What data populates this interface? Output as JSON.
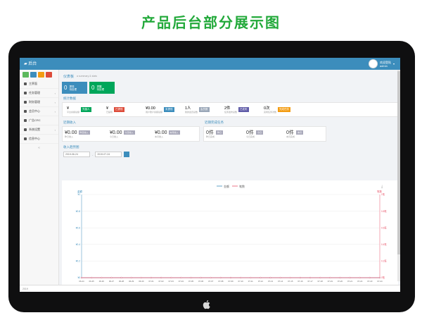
{
  "banner": "产品后台部分展示图",
  "app": {
    "title": "后台",
    "user_name": "欢迎登陆",
    "user_sub": "admin"
  },
  "sidebar": {
    "top_buttons": [
      {
        "name": "home-shortcut-button",
        "color": "#5cb85c"
      },
      {
        "name": "edit-shortcut-button",
        "color": "#3c8dbc"
      },
      {
        "name": "user-shortcut-button",
        "color": "#f39c12"
      },
      {
        "name": "settings-shortcut-button",
        "color": "#dd4b39"
      }
    ],
    "items": [
      {
        "label": "主界面",
        "icon": "home-icon",
        "arrow": ""
      },
      {
        "label": "任务管理",
        "icon": "flag-icon",
        "arrow": "‹"
      },
      {
        "label": "财务管理",
        "icon": "money-icon",
        "arrow": "‹"
      },
      {
        "label": "会员中心",
        "icon": "user-icon",
        "arrow": "‹"
      },
      {
        "label": "广告CRC",
        "icon": "ad-icon",
        "arrow": ""
      },
      {
        "label": "系统设置",
        "icon": "gear-icon",
        "arrow": "‹"
      },
      {
        "label": "信息中心",
        "icon": "message-icon",
        "arrow": ""
      }
    ]
  },
  "main": {
    "breadcrumb": "仪表板",
    "breadcrumb_sub": "a summary & stats",
    "cards": [
      {
        "num": "0",
        "label": "提现",
        "sub": "待处理",
        "color": "#3c8dbc"
      },
      {
        "num": "0",
        "label": "提醒",
        "sub": "待处理",
        "color": "#00a65a"
      }
    ],
    "stats_title": "统计数据",
    "stats": [
      {
        "val": "¥",
        "cap": "平台余额总额",
        "tag": "充值人",
        "tag_color": "#00a65a"
      },
      {
        "val": "¥",
        "cap": "已提现",
        "tag": "已提现",
        "tag_color": "#dd4b39"
      },
      {
        "val": "¥0.00",
        "cap": "用户账户余额总额",
        "tag": "未提现",
        "tag_color": "#3c8dbc"
      },
      {
        "val": "1人",
        "cap": "我的会员总数",
        "tag": "会员数",
        "tag_color": "#9aa7b8"
      },
      {
        "val": "2件",
        "cap": "任务发布总数",
        "tag": "已发布",
        "tag_color": "#605ca8"
      },
      {
        "val": "0次",
        "cap": "完成任务次数",
        "tag": "完成任务",
        "tag_color": "#f39c12"
      }
    ],
    "recent_income_title": "近期收入",
    "income": [
      {
        "val": "¥0.00",
        "cap": "昨日收入",
        "tag": "昨日收入"
      },
      {
        "val": "¥0.00",
        "cap": "今日收入",
        "tag": "今日收入"
      },
      {
        "val": "¥0.00",
        "cap": "本月收入",
        "tag": "本月收入"
      }
    ],
    "recent_tasks_title": "近期完成任务",
    "tasks": [
      {
        "val": "0件",
        "cap": "昨日完成",
        "tag": "昨日"
      },
      {
        "val": "0件",
        "cap": "今日完成",
        "tag": "今日"
      },
      {
        "val": "0件",
        "cap": "本月完成",
        "tag": "本月"
      }
    ],
    "trend_title": "收入趋势图",
    "date_from": "2019-06-24",
    "date_to": "2019-07-24"
  },
  "chart_data": {
    "type": "line",
    "title": "",
    "legend": [
      "金额",
      "笔数"
    ],
    "xlabel": "",
    "y_left_label": "金额",
    "y_right_label": "笔数",
    "ylim_left": [
      0,
      1
    ],
    "ylim_right": [
      0,
      1
    ],
    "y_left_ticks": [
      "¥1",
      "¥0.8",
      "¥0.6",
      "¥0.4",
      "¥0.2",
      "¥0"
    ],
    "y_right_ticks": [
      "1笔",
      "0.8笔",
      "0.6笔",
      "0.4笔",
      "0.2笔",
      "0笔"
    ],
    "categories": [
      "06-24",
      "06-25",
      "06-26",
      "06-27",
      "06-28",
      "06-29",
      "06-30",
      "07-01",
      "07-02",
      "07-03",
      "07-04",
      "07-05",
      "07-06",
      "07-07",
      "07-08",
      "07-09",
      "07-10",
      "07-11",
      "07-12",
      "07-13",
      "07-14",
      "07-15",
      "07-16",
      "07-17",
      "07-18",
      "07-19",
      "07-20",
      "07-21",
      "07-22",
      "07-23",
      "07-24"
    ],
    "series": [
      {
        "name": "金额",
        "values": [
          0,
          0,
          0,
          0,
          0,
          0,
          0,
          0,
          0,
          0,
          0,
          0,
          0,
          0,
          0,
          0,
          0,
          0,
          0,
          0,
          0,
          0,
          0,
          0,
          0,
          0,
          0,
          0,
          0,
          0,
          0
        ],
        "color": "#3c8dbc"
      },
      {
        "name": "笔数",
        "values": [
          0,
          0,
          0,
          0,
          0,
          0,
          0,
          0,
          0,
          0,
          0,
          0,
          0,
          0,
          0,
          0,
          0,
          0,
          0,
          0,
          0,
          0,
          0,
          0,
          0,
          0,
          0,
          0,
          0,
          0,
          0
        ],
        "color": "#e8556a"
      }
    ]
  },
  "status": {
    "text": "2019"
  }
}
